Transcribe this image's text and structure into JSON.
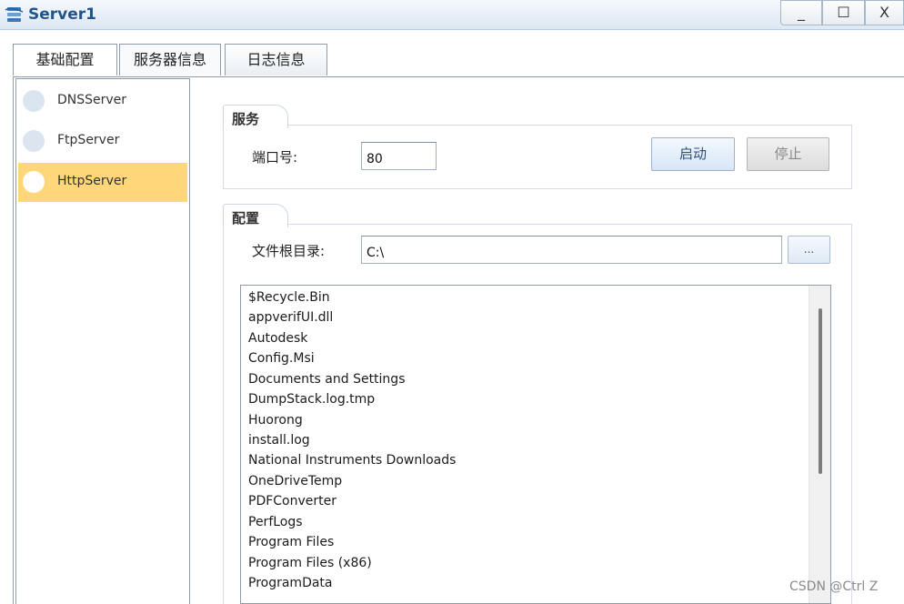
{
  "window": {
    "title": "Server1",
    "minimize": "_",
    "maximize": "☐",
    "close": "X"
  },
  "tabs": [
    {
      "label": "基础配置"
    },
    {
      "label": "服务器信息"
    },
    {
      "label": "日志信息"
    }
  ],
  "servers": [
    {
      "label": "DNSServer"
    },
    {
      "label": "FtpServer"
    },
    {
      "label": "HttpServer"
    }
  ],
  "service": {
    "group_title": "服务",
    "port_label": "端口号:",
    "port_value": "80",
    "start_label": "启动",
    "stop_label": "停止"
  },
  "config": {
    "group_title": "配置",
    "root_label": "文件根目录:",
    "root_value": "C:\\",
    "browse_label": "..."
  },
  "files": [
    "$Recycle.Bin",
    "appverifUI.dll",
    "Autodesk",
    "Config.Msi",
    "Documents and Settings",
    "DumpStack.log.tmp",
    "Huorong",
    "install.log",
    "National Instruments Downloads",
    "OneDriveTemp",
    "PDFConverter",
    "PerfLogs",
    "Program Files",
    "Program Files (x86)",
    "ProgramData"
  ],
  "watermark": "CSDN @Ctrl Z"
}
